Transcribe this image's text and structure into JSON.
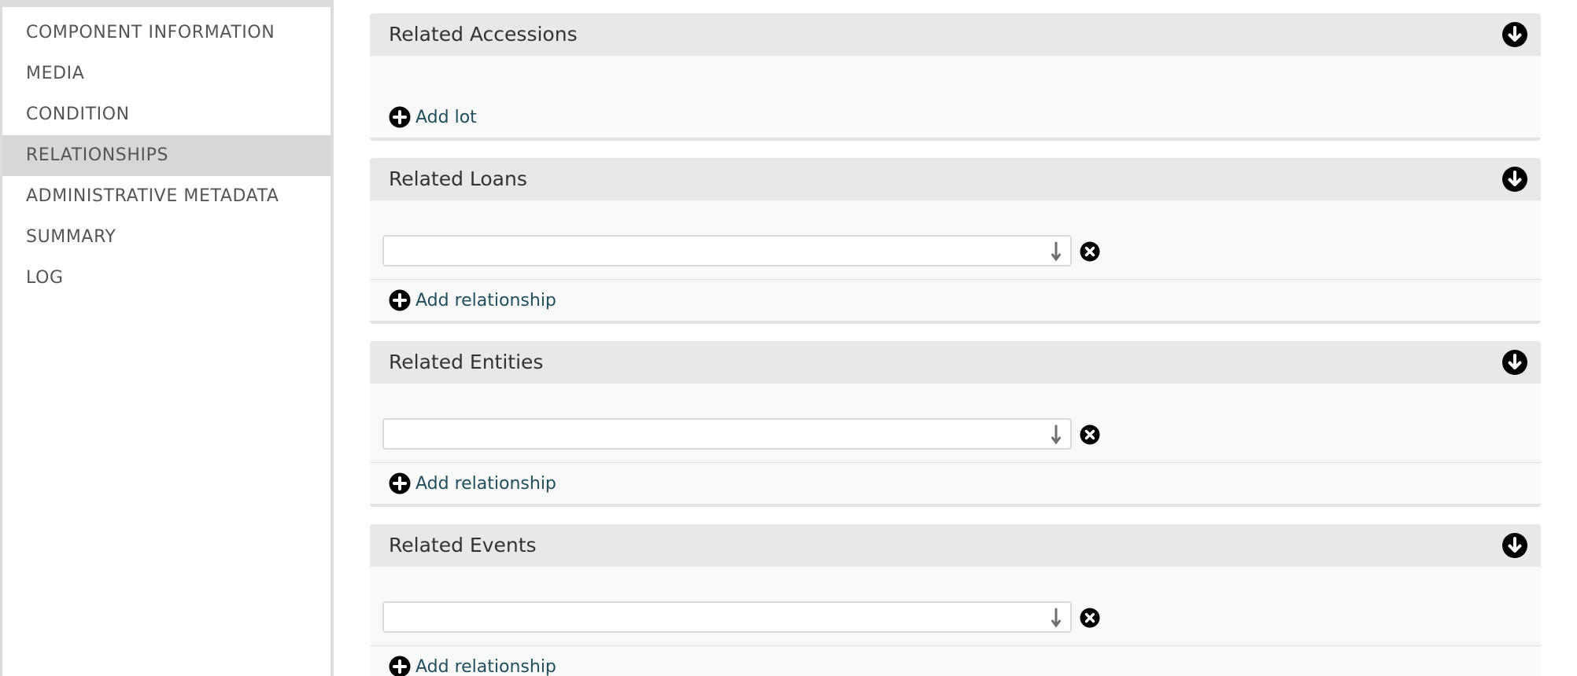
{
  "sidebar": {
    "items": [
      {
        "label": "COMPONENT INFORMATION"
      },
      {
        "label": "MEDIA"
      },
      {
        "label": "CONDITION"
      },
      {
        "label": "RELATIONSHIPS",
        "active": true
      },
      {
        "label": "ADMINISTRATIVE METADATA"
      },
      {
        "label": "SUMMARY"
      },
      {
        "label": "LOG"
      }
    ]
  },
  "panels": {
    "accessions": {
      "title": "Related Accessions",
      "add_label": "Add lot",
      "toggle_icon": "arrow-down-circle-icon"
    },
    "loans": {
      "title": "Related Loans",
      "add_label": "Add relationship",
      "field_value": "",
      "toggle_icon": "arrow-down-circle-icon"
    },
    "entities": {
      "title": "Related Entities",
      "add_label": "Add relationship",
      "field_value": "",
      "toggle_icon": "arrow-down-circle-icon"
    },
    "events": {
      "title": "Related Events",
      "add_label": "Add relationship",
      "field_value": "",
      "toggle_icon": "arrow-down-circle-icon"
    }
  },
  "colors": {
    "link": "#1f4f5e",
    "header_bg": "#e8e8e8",
    "active_item_bg": "#d7d7d7",
    "icon": "#000000"
  }
}
